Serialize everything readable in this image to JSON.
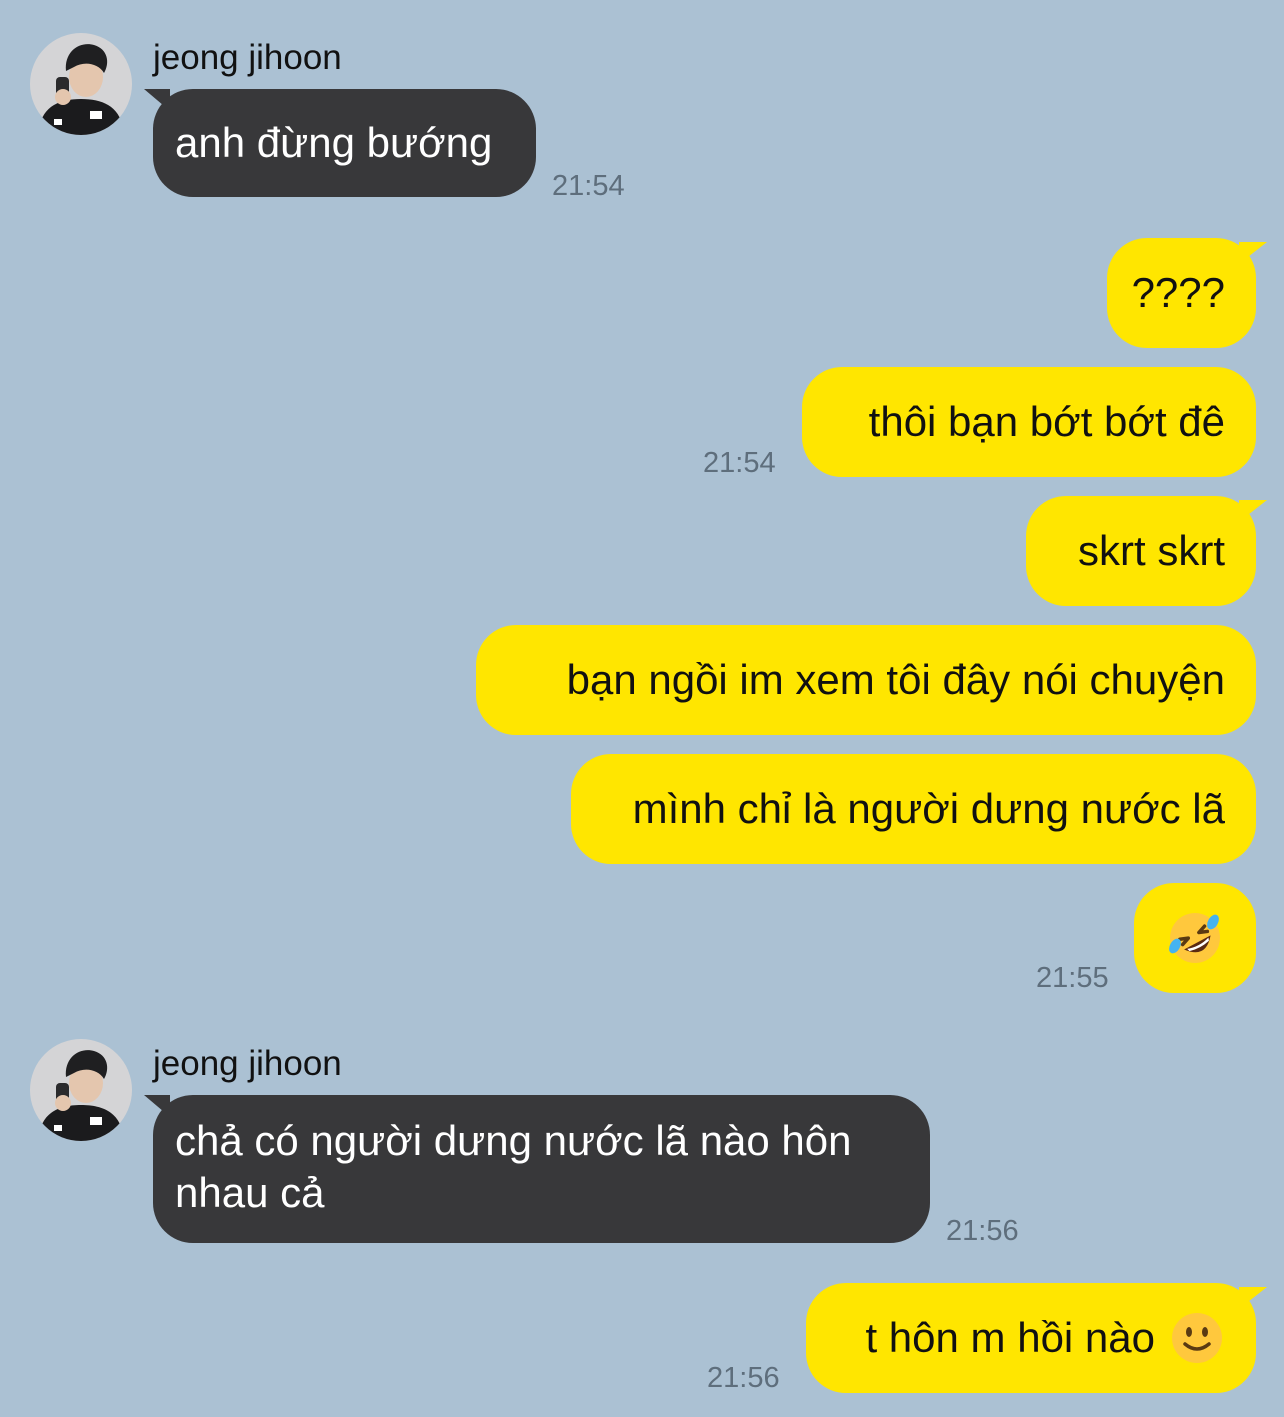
{
  "messages": [
    {
      "sender": "jeong jihoon",
      "text": "anh đừng bướng",
      "time": "21:54"
    },
    {
      "text": "????"
    },
    {
      "text": "thôi bạn bớt bớt đê",
      "time": "21:54"
    },
    {
      "text": "skrt skrt"
    },
    {
      "text": "bạn ngồi im xem tôi đây nói chuyện"
    },
    {
      "text": "mình chỉ là người dưng nước lã"
    },
    {
      "emoji": "rolling-on-floor-laughing-emoji",
      "time": "21:55"
    },
    {
      "sender": "jeong jihoon",
      "text": "chả có người dưng nước lã nào hôn nhau cả",
      "time": "21:56"
    },
    {
      "text": "t hôn m hồi nào",
      "emoji": "slightly-smiling-face-emoji",
      "time": "21:56"
    }
  ],
  "colors": {
    "background": "#abc1d3",
    "incoming_bubble": "#38383a",
    "outgoing_bubble": "#ffe600",
    "timestamp": "#5e6e7c"
  }
}
